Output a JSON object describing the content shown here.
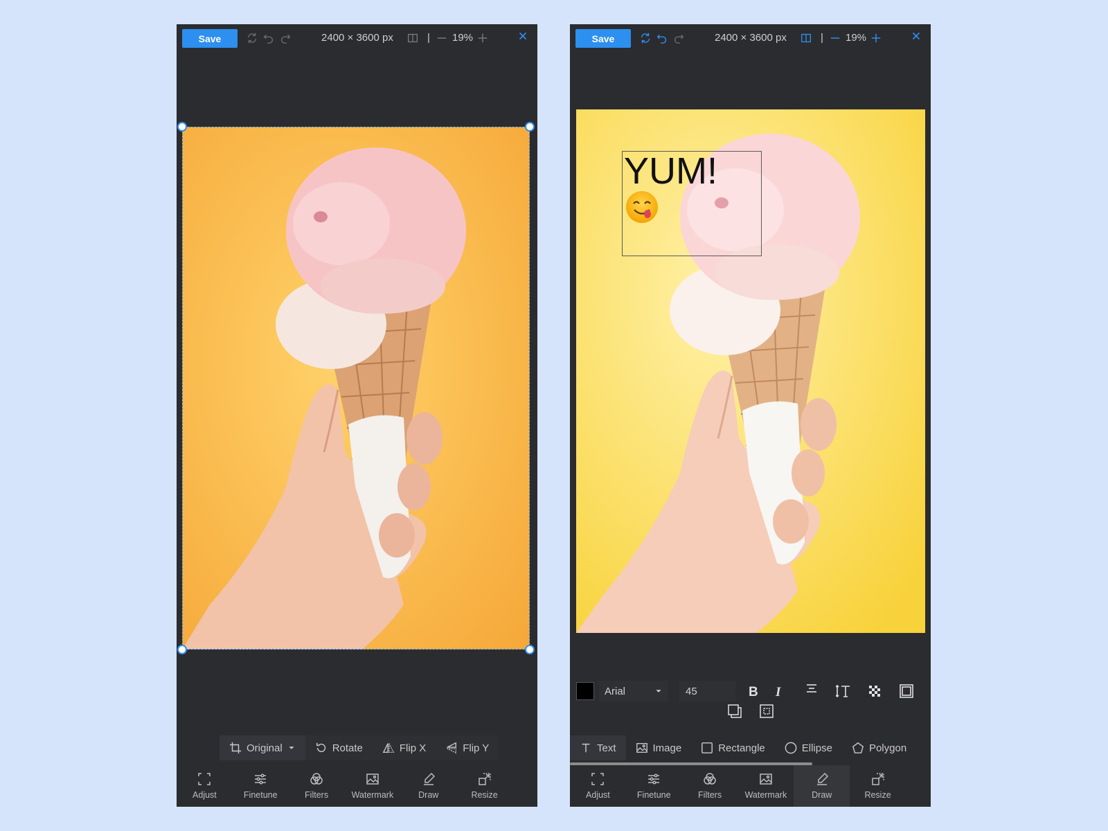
{
  "left_panel": {
    "toolbar": {
      "save_label": "Save",
      "dimensions": "2400 × 3600 px",
      "separator": "|",
      "zoom": "19%"
    },
    "crop_tools": [
      {
        "label": "Original"
      },
      {
        "label": "Rotate"
      },
      {
        "label": "Flip X"
      },
      {
        "label": "Flip Y"
      }
    ]
  },
  "right_panel": {
    "toolbar": {
      "save_label": "Save",
      "dimensions": "2400 × 3600 px",
      "separator": "|",
      "zoom": "19%"
    },
    "annotation": {
      "text": "YUM!"
    },
    "text_settings": {
      "color": "#000000",
      "font": "Arial",
      "size": "45"
    },
    "draw_tools": [
      {
        "label": "Text"
      },
      {
        "label": "Image"
      },
      {
        "label": "Rectangle"
      },
      {
        "label": "Ellipse"
      },
      {
        "label": "Polygon"
      }
    ]
  },
  "bottom_nav": [
    {
      "label": "Adjust",
      "icon": "adjust-icon"
    },
    {
      "label": "Finetune",
      "icon": "sliders-icon"
    },
    {
      "label": "Filters",
      "icon": "filters-icon"
    },
    {
      "label": "Watermark",
      "icon": "watermark-icon"
    },
    {
      "label": "Draw",
      "icon": "pencil-icon"
    },
    {
      "label": "Resize",
      "icon": "resize-icon"
    }
  ],
  "colors": {
    "accent": "#2d8ff0",
    "panel_bg": "#2b2c2f",
    "page_bg": "#d6e4fb"
  }
}
